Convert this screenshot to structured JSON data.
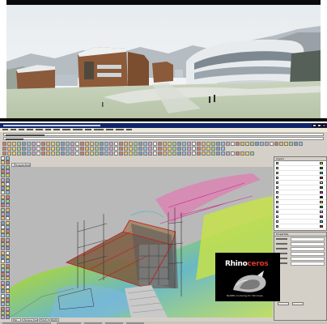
{
  "render": {},
  "rhino_window": {
    "title": "",
    "menu_items": [
      "",
      "",
      "",
      "",
      "",
      "",
      "",
      "",
      "",
      "",
      "",
      "",
      "",
      ""
    ],
    "command_history": "",
    "command_prompt": "",
    "viewport_label": "Perspective",
    "view_tabs": [
      "Top",
      "Perspective",
      "Front",
      "Right"
    ],
    "layers_panel": {
      "header": "Layers",
      "layers": [
        {
          "name": "",
          "color": "#ffff00"
        },
        {
          "name": "",
          "color": "#00b000"
        },
        {
          "name": "",
          "color": "#00ffff"
        },
        {
          "name": "",
          "color": "#ff0000"
        },
        {
          "name": "",
          "color": "#ffffff"
        },
        {
          "name": "",
          "color": "#008000"
        },
        {
          "name": "",
          "color": "#ff00ff"
        },
        {
          "name": "",
          "color": "#000000"
        },
        {
          "name": "",
          "color": "#ffff00"
        },
        {
          "name": "",
          "color": "#00b000"
        },
        {
          "name": "",
          "color": "#ffffff"
        },
        {
          "name": "",
          "color": "#ff00ff"
        },
        {
          "name": "",
          "color": "#00ffff"
        },
        {
          "name": "",
          "color": "#ff0000"
        },
        {
          "name": "",
          "color": "#ffffff"
        },
        {
          "name": "",
          "color": "#008000"
        },
        {
          "name": "",
          "color": "#ff0000"
        },
        {
          "name": "",
          "color": "#00ff00"
        },
        {
          "name": "",
          "color": "#ffffff"
        },
        {
          "name": "",
          "color": "#ff0000"
        }
      ]
    },
    "properties_panel": {
      "header": "Properties"
    },
    "logo": {
      "word_main": "Rhino",
      "word_accent": "ceros",
      "tagline": "NURBS modeling for Windows"
    },
    "status_bar": ""
  },
  "colors": {
    "titlebar": "#10246a",
    "panel_bg": "#d4d0c8",
    "viewport_bg": "#b9b9b9",
    "selection": "#0a246a"
  }
}
